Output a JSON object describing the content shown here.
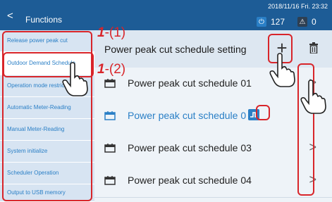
{
  "header": {
    "back_glyph": "<",
    "title": "Functions",
    "datetime": "2018/11/16 Fri. 23:32",
    "power_count": "127",
    "alert_count": "0"
  },
  "sidebar": {
    "items": [
      {
        "label": "Release power peak cut"
      },
      {
        "label": "Outdoor Demand Schedule"
      },
      {
        "label": "Operation mode restriction"
      },
      {
        "label": "Automatic Meter-Reading"
      },
      {
        "label": "Manual Meter-Reading"
      },
      {
        "label": "System initialize"
      },
      {
        "label": "Scheduler Operation"
      },
      {
        "label": "Output to USB memory"
      }
    ]
  },
  "main": {
    "heading": "Power peak cut schedule setting",
    "add_glyph": "+",
    "rows": [
      {
        "label": "Power peak cut schedule 01"
      },
      {
        "label": "Power peak cut schedule 0"
      },
      {
        "label": "Power peak cut schedule 03"
      },
      {
        "label": "Power peak cut schedule 04"
      }
    ],
    "chevron": ">"
  },
  "annotations": {
    "step1_num": "1",
    "step1_sub": "-(1)",
    "step2_num": "1",
    "step2_sub": "-(2)"
  },
  "colors": {
    "header_bg": "#1d5c96",
    "sidebar_bg": "#d7e4f2",
    "accent_blue": "#2a7fc6",
    "callout_red": "#d8252a"
  }
}
